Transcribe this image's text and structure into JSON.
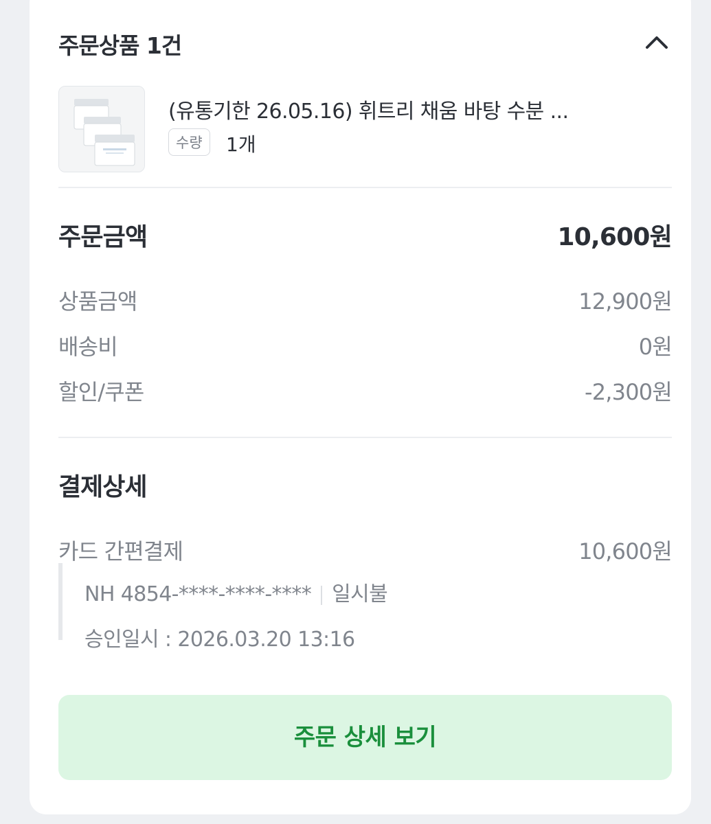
{
  "order_items": {
    "title": "주문상품 1건",
    "collapse_icon": "chevron-up-icon",
    "product": {
      "name": "(유통기한 26.05.16) 휘트리 채움 바탕 수분 ...",
      "quantity_label": "수량",
      "quantity_value": "1개"
    }
  },
  "order_amount": {
    "title": "주문금액",
    "total": "10,600원",
    "lines": [
      {
        "label": "상품금액",
        "value": "12,900원"
      },
      {
        "label": "배송비",
        "value": "0원"
      },
      {
        "label": "할인/쿠폰",
        "value": "-2,300원"
      }
    ]
  },
  "payment": {
    "title": "결제상세",
    "method": "카드 간편결제",
    "amount": "10,600원",
    "card_number": "NH 4854-****-****-****",
    "installment": "일시불",
    "approval": "승인일시 : 2026.03.20 13:16"
  },
  "actions": {
    "detail_button": "주문 상세 보기"
  },
  "colors": {
    "accent_green": "#1a8f3c",
    "button_bg": "#dcf6e3"
  }
}
